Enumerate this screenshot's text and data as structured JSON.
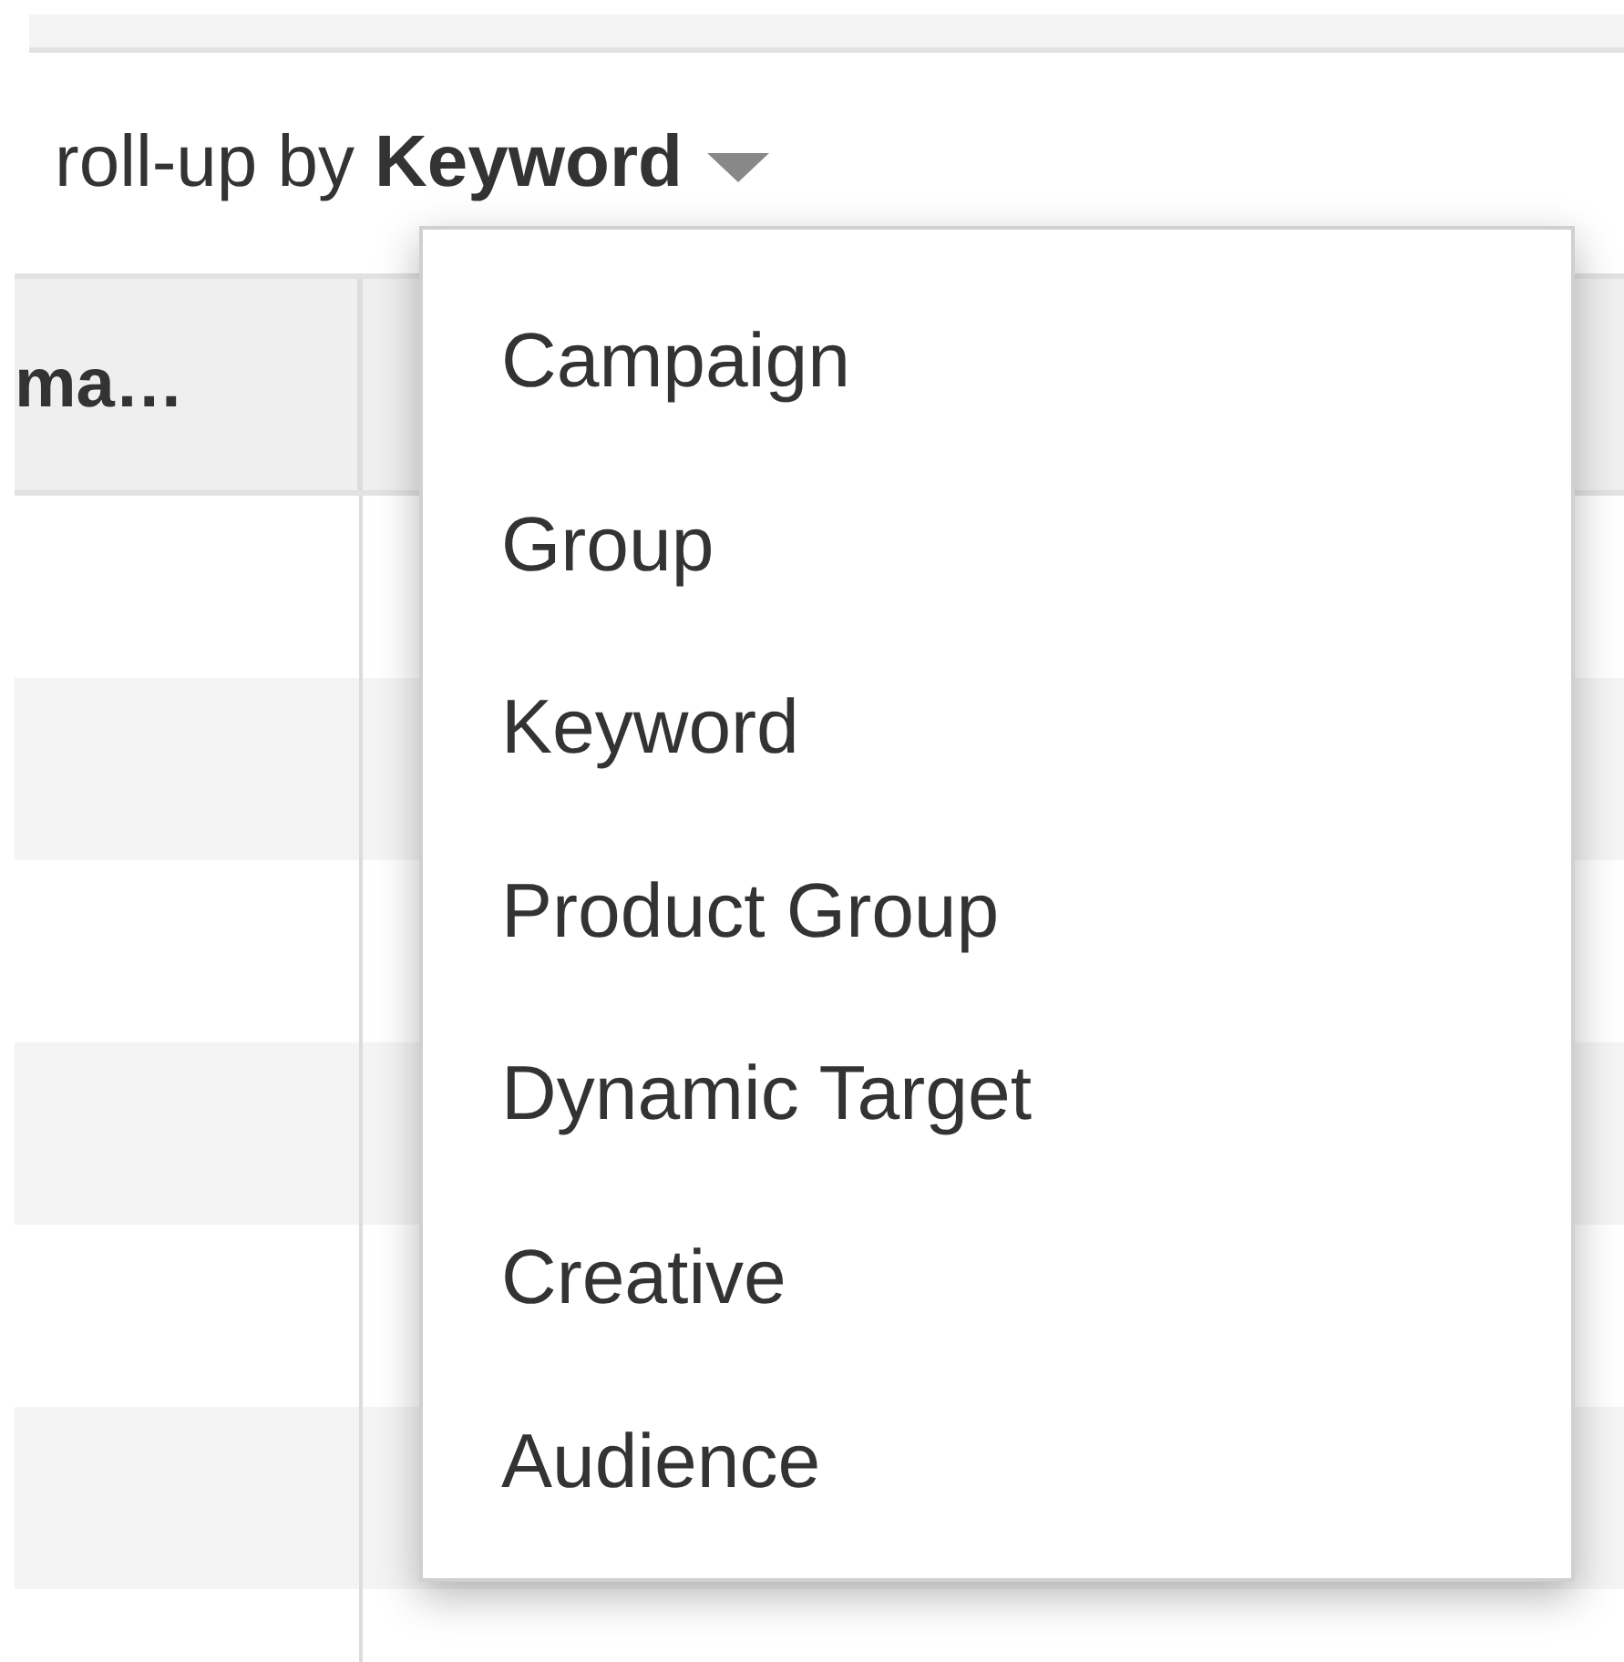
{
  "rollup": {
    "label": "roll-up by",
    "value": "Keyword"
  },
  "table": {
    "columns": [
      "ma…"
    ]
  },
  "menu": {
    "items": [
      {
        "label": "Campaign",
        "selected": false
      },
      {
        "label": "Group",
        "selected": false
      },
      {
        "label": "Keyword",
        "selected": false
      },
      {
        "label": "Product Group",
        "selected": false
      },
      {
        "label": "Dynamic Target",
        "selected": false
      },
      {
        "label": "Creative",
        "selected": false
      },
      {
        "label": "Audience",
        "selected": false
      }
    ]
  }
}
